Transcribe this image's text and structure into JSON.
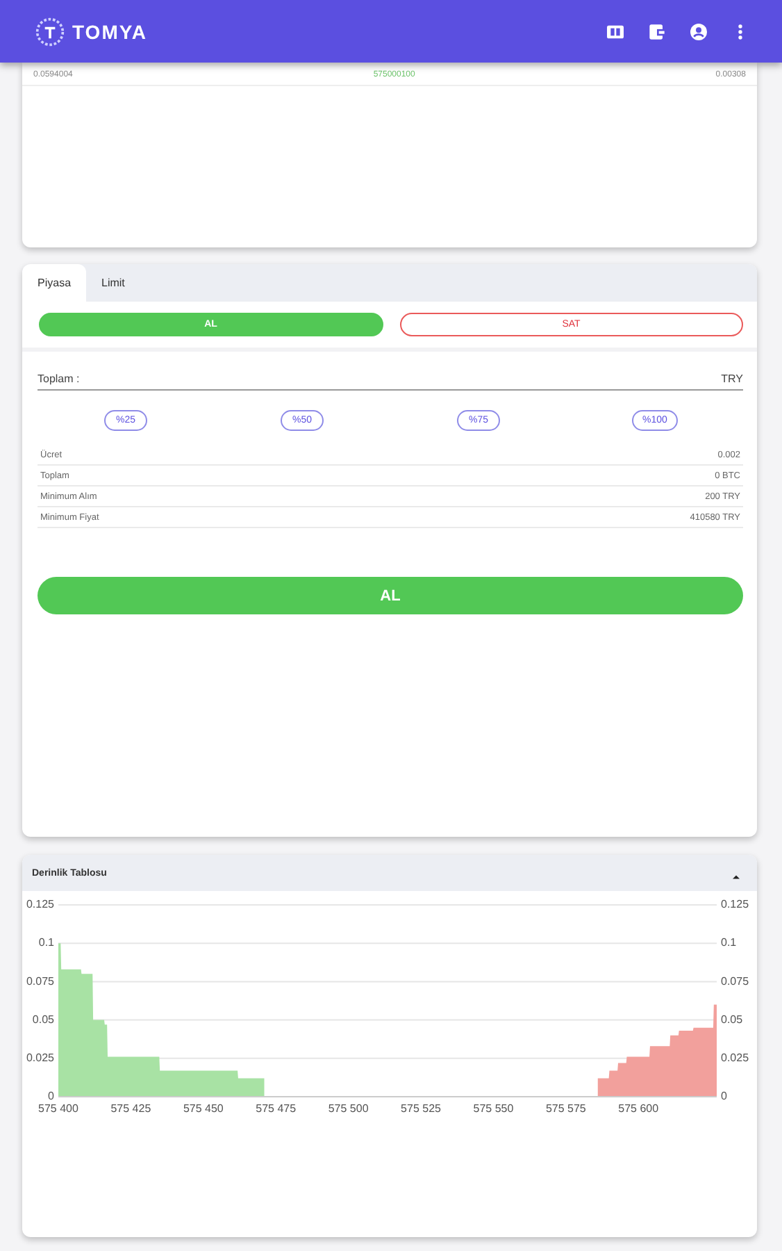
{
  "app_bar": {
    "title": "TOMYA"
  },
  "trades_row": {
    "column_1": "0.0594004",
    "column_2": "575000100",
    "column_3": "0.00308"
  },
  "order_panel": {
    "tabs": [
      {
        "label": "Piyasa",
        "selected": true
      },
      {
        "label": "Limit",
        "selected": false
      }
    ],
    "sides": [
      {
        "label": "AL",
        "kind": "buy",
        "selected": true
      },
      {
        "label": "SAT",
        "kind": "sell",
        "selected": false
      }
    ],
    "total_field": {
      "label": "Toplam :",
      "unit": "TRY"
    },
    "percent_buttons": [
      "%25",
      "%50",
      "%75",
      "%100"
    ],
    "info_rows": [
      {
        "label": "Ücret",
        "value": "0.002"
      },
      {
        "label": "Toplam",
        "value": "0 BTC"
      },
      {
        "label": "Minimum Alım",
        "value": "200 TRY"
      },
      {
        "label": "Minimum Fiyat",
        "value": "410580 TRY"
      }
    ],
    "submit": {
      "label": "AL",
      "kind": "buy"
    }
  },
  "depth_panel": {
    "title": "Derinlik Tablosu",
    "expanded": true,
    "right_axis_labels": [
      "0.125",
      "0.1",
      "0.075",
      "0.05",
      "0.025",
      "0"
    ],
    "chart_data": {
      "type": "area",
      "grid": true,
      "x": [
        575400,
        575400.8,
        575401,
        575407.8,
        575408,
        575411.8,
        575412,
        575415.8,
        575416,
        575416.8,
        575417,
        575434.8,
        575435,
        575461.8,
        575462,
        575471,
        575586,
        575589.8,
        575590,
        575592.8,
        575593,
        575595.8,
        575596,
        575603.8,
        575604,
        575610.8,
        575611,
        575613.8,
        575614,
        575618.8,
        575619,
        575625.8,
        575626,
        575627
      ],
      "series": [
        {
          "color": "#a8e2a4",
          "values": [
            0.1,
            0.1,
            0.083,
            0.083,
            0.08,
            0.08,
            0.05,
            0.05,
            0.047,
            0.047,
            0.026,
            0.026,
            0.017,
            0.017,
            0.012,
            0.012,
            null,
            null,
            null,
            null,
            null,
            null,
            null,
            null,
            null,
            null,
            null,
            null,
            null,
            null,
            null,
            null,
            null,
            null
          ]
        },
        {
          "color": "#f2a09c",
          "values": [
            null,
            null,
            null,
            null,
            null,
            null,
            null,
            null,
            null,
            null,
            null,
            null,
            null,
            null,
            null,
            null,
            0.012,
            0.012,
            0.017,
            0.017,
            0.022,
            0.022,
            0.026,
            0.026,
            0.033,
            0.033,
            0.04,
            0.04,
            0.043,
            0.043,
            0.045,
            0.045,
            0.06,
            0.06
          ]
        }
      ],
      "xlim": [
        575400,
        575627
      ],
      "ylim": [
        0,
        0.125
      ],
      "xticks": [
        {
          "value": 575400,
          "label": "575 400"
        },
        {
          "value": 575425,
          "label": "575 425"
        },
        {
          "value": 575450,
          "label": "575 450"
        },
        {
          "value": 575475,
          "label": "575 475"
        },
        {
          "value": 575500,
          "label": "575 500"
        },
        {
          "value": 575525,
          "label": "575 525"
        },
        {
          "value": 575550,
          "label": "575 550"
        },
        {
          "value": 575575,
          "label": "575 575"
        },
        {
          "value": 575600,
          "label": "575 600"
        }
      ],
      "yticks": [
        0,
        0.025,
        0.05,
        0.075,
        0.1,
        0.125
      ]
    }
  }
}
